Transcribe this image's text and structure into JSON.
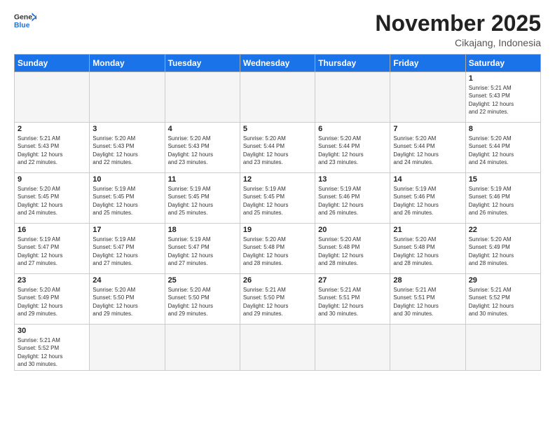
{
  "header": {
    "logo_general": "General",
    "logo_blue": "Blue",
    "month": "November 2025",
    "location": "Cikajang, Indonesia"
  },
  "days_of_week": [
    "Sunday",
    "Monday",
    "Tuesday",
    "Wednesday",
    "Thursday",
    "Friday",
    "Saturday"
  ],
  "weeks": [
    [
      {
        "day": "",
        "info": ""
      },
      {
        "day": "",
        "info": ""
      },
      {
        "day": "",
        "info": ""
      },
      {
        "day": "",
        "info": ""
      },
      {
        "day": "",
        "info": ""
      },
      {
        "day": "",
        "info": ""
      },
      {
        "day": "1",
        "info": "Sunrise: 5:21 AM\nSunset: 5:43 PM\nDaylight: 12 hours\nand 22 minutes."
      }
    ],
    [
      {
        "day": "2",
        "info": "Sunrise: 5:21 AM\nSunset: 5:43 PM\nDaylight: 12 hours\nand 22 minutes."
      },
      {
        "day": "3",
        "info": "Sunrise: 5:20 AM\nSunset: 5:43 PM\nDaylight: 12 hours\nand 22 minutes."
      },
      {
        "day": "4",
        "info": "Sunrise: 5:20 AM\nSunset: 5:43 PM\nDaylight: 12 hours\nand 23 minutes."
      },
      {
        "day": "5",
        "info": "Sunrise: 5:20 AM\nSunset: 5:44 PM\nDaylight: 12 hours\nand 23 minutes."
      },
      {
        "day": "6",
        "info": "Sunrise: 5:20 AM\nSunset: 5:44 PM\nDaylight: 12 hours\nand 23 minutes."
      },
      {
        "day": "7",
        "info": "Sunrise: 5:20 AM\nSunset: 5:44 PM\nDaylight: 12 hours\nand 24 minutes."
      },
      {
        "day": "8",
        "info": "Sunrise: 5:20 AM\nSunset: 5:44 PM\nDaylight: 12 hours\nand 24 minutes."
      }
    ],
    [
      {
        "day": "9",
        "info": "Sunrise: 5:20 AM\nSunset: 5:45 PM\nDaylight: 12 hours\nand 24 minutes."
      },
      {
        "day": "10",
        "info": "Sunrise: 5:19 AM\nSunset: 5:45 PM\nDaylight: 12 hours\nand 25 minutes."
      },
      {
        "day": "11",
        "info": "Sunrise: 5:19 AM\nSunset: 5:45 PM\nDaylight: 12 hours\nand 25 minutes."
      },
      {
        "day": "12",
        "info": "Sunrise: 5:19 AM\nSunset: 5:45 PM\nDaylight: 12 hours\nand 25 minutes."
      },
      {
        "day": "13",
        "info": "Sunrise: 5:19 AM\nSunset: 5:46 PM\nDaylight: 12 hours\nand 26 minutes."
      },
      {
        "day": "14",
        "info": "Sunrise: 5:19 AM\nSunset: 5:46 PM\nDaylight: 12 hours\nand 26 minutes."
      },
      {
        "day": "15",
        "info": "Sunrise: 5:19 AM\nSunset: 5:46 PM\nDaylight: 12 hours\nand 26 minutes."
      }
    ],
    [
      {
        "day": "16",
        "info": "Sunrise: 5:19 AM\nSunset: 5:47 PM\nDaylight: 12 hours\nand 27 minutes."
      },
      {
        "day": "17",
        "info": "Sunrise: 5:19 AM\nSunset: 5:47 PM\nDaylight: 12 hours\nand 27 minutes."
      },
      {
        "day": "18",
        "info": "Sunrise: 5:19 AM\nSunset: 5:47 PM\nDaylight: 12 hours\nand 27 minutes."
      },
      {
        "day": "19",
        "info": "Sunrise: 5:20 AM\nSunset: 5:48 PM\nDaylight: 12 hours\nand 28 minutes."
      },
      {
        "day": "20",
        "info": "Sunrise: 5:20 AM\nSunset: 5:48 PM\nDaylight: 12 hours\nand 28 minutes."
      },
      {
        "day": "21",
        "info": "Sunrise: 5:20 AM\nSunset: 5:48 PM\nDaylight: 12 hours\nand 28 minutes."
      },
      {
        "day": "22",
        "info": "Sunrise: 5:20 AM\nSunset: 5:49 PM\nDaylight: 12 hours\nand 28 minutes."
      }
    ],
    [
      {
        "day": "23",
        "info": "Sunrise: 5:20 AM\nSunset: 5:49 PM\nDaylight: 12 hours\nand 29 minutes."
      },
      {
        "day": "24",
        "info": "Sunrise: 5:20 AM\nSunset: 5:50 PM\nDaylight: 12 hours\nand 29 minutes."
      },
      {
        "day": "25",
        "info": "Sunrise: 5:20 AM\nSunset: 5:50 PM\nDaylight: 12 hours\nand 29 minutes."
      },
      {
        "day": "26",
        "info": "Sunrise: 5:21 AM\nSunset: 5:50 PM\nDaylight: 12 hours\nand 29 minutes."
      },
      {
        "day": "27",
        "info": "Sunrise: 5:21 AM\nSunset: 5:51 PM\nDaylight: 12 hours\nand 30 minutes."
      },
      {
        "day": "28",
        "info": "Sunrise: 5:21 AM\nSunset: 5:51 PM\nDaylight: 12 hours\nand 30 minutes."
      },
      {
        "day": "29",
        "info": "Sunrise: 5:21 AM\nSunset: 5:52 PM\nDaylight: 12 hours\nand 30 minutes."
      }
    ],
    [
      {
        "day": "30",
        "info": "Sunrise: 5:21 AM\nSunset: 5:52 PM\nDaylight: 12 hours\nand 30 minutes."
      },
      {
        "day": "",
        "info": ""
      },
      {
        "day": "",
        "info": ""
      },
      {
        "day": "",
        "info": ""
      },
      {
        "day": "",
        "info": ""
      },
      {
        "day": "",
        "info": ""
      },
      {
        "day": "",
        "info": ""
      }
    ]
  ]
}
